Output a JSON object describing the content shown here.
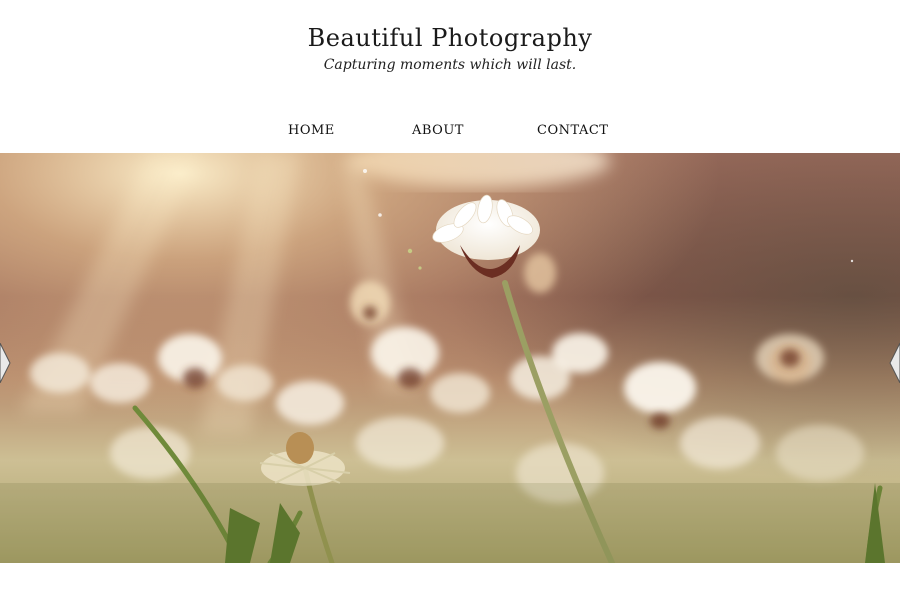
{
  "site": {
    "title": "Beautiful Photography",
    "tagline": "Capturing moments which will last."
  },
  "nav": {
    "items": [
      {
        "label": "HOME"
      },
      {
        "label": "ABOUT"
      },
      {
        "label": "CONTACT"
      }
    ]
  },
  "slider": {
    "image_subject": "daisy-field-photo",
    "prev_icon": "chevron-left-icon",
    "next_icon": "chevron-right-icon",
    "colors": {
      "sky_top": "#8f5d50",
      "warm_glow": "#f2d9a8",
      "meadow": "#c9b98a",
      "grass": "#6f8a3a",
      "petal": "#fbf6ee",
      "center": "#6b2e22"
    }
  }
}
